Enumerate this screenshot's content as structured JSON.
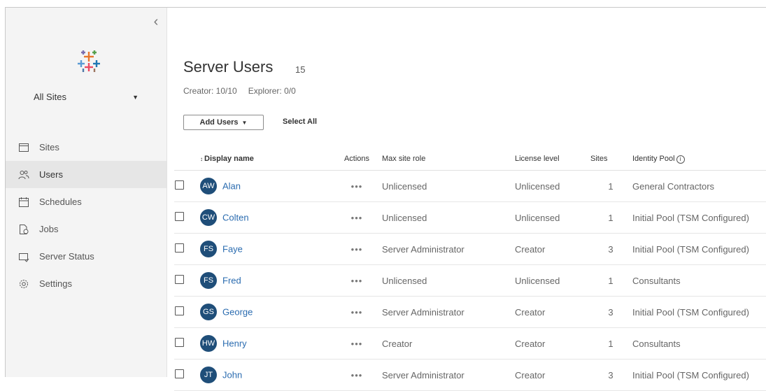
{
  "sidebar": {
    "site_selector": "All Sites",
    "items": [
      {
        "label": "Sites",
        "icon": "sites-icon"
      },
      {
        "label": "Users",
        "icon": "users-icon",
        "active": true
      },
      {
        "label": "Schedules",
        "icon": "schedules-icon"
      },
      {
        "label": "Jobs",
        "icon": "jobs-icon"
      },
      {
        "label": "Server Status",
        "icon": "server-status-icon"
      },
      {
        "label": "Settings",
        "icon": "gear-icon"
      }
    ]
  },
  "header": {
    "title": "Server Users",
    "count": "15",
    "creator_license": "Creator: 10/10",
    "explorer_license": "Explorer: 0/0"
  },
  "toolbar": {
    "add_users_label": "Add Users",
    "select_all_label": "Select All"
  },
  "table": {
    "columns": {
      "display_name": "Display name",
      "actions": "Actions",
      "max_site_role": "Max site role",
      "license_level": "License level",
      "sites": "Sites",
      "identity_pool": "Identity Pool"
    },
    "actions_glyph": "•••",
    "rows": [
      {
        "initials": "AW",
        "name": "Alan",
        "role": "Unlicensed",
        "license": "Unlicensed",
        "sites": "1",
        "pool": "General Contractors"
      },
      {
        "initials": "CW",
        "name": "Colten",
        "role": "Unlicensed",
        "license": "Unlicensed",
        "sites": "1",
        "pool": "Initial Pool (TSM Configured)"
      },
      {
        "initials": "FS",
        "name": "Faye",
        "role": "Server Administrator",
        "license": "Creator",
        "sites": "3",
        "pool": "Initial Pool (TSM Configured)"
      },
      {
        "initials": "FS",
        "name": "Fred",
        "role": "Unlicensed",
        "license": "Unlicensed",
        "sites": "1",
        "pool": "Consultants"
      },
      {
        "initials": "GS",
        "name": "George",
        "role": "Server Administrator",
        "license": "Creator",
        "sites": "3",
        "pool": "Initial Pool (TSM Configured)"
      },
      {
        "initials": "HW",
        "name": "Henry",
        "role": "Creator",
        "license": "Creator",
        "sites": "1",
        "pool": "Consultants"
      },
      {
        "initials": "JT",
        "name": "John",
        "role": "Server Administrator",
        "license": "Creator",
        "sites": "3",
        "pool": "Initial Pool (TSM Configured)"
      }
    ]
  },
  "colors": {
    "avatar_bg": "#1f4e79",
    "link": "#2b6cb0",
    "sidebar_bg": "#f4f4f4",
    "active_item_bg": "#e6e6e6"
  }
}
